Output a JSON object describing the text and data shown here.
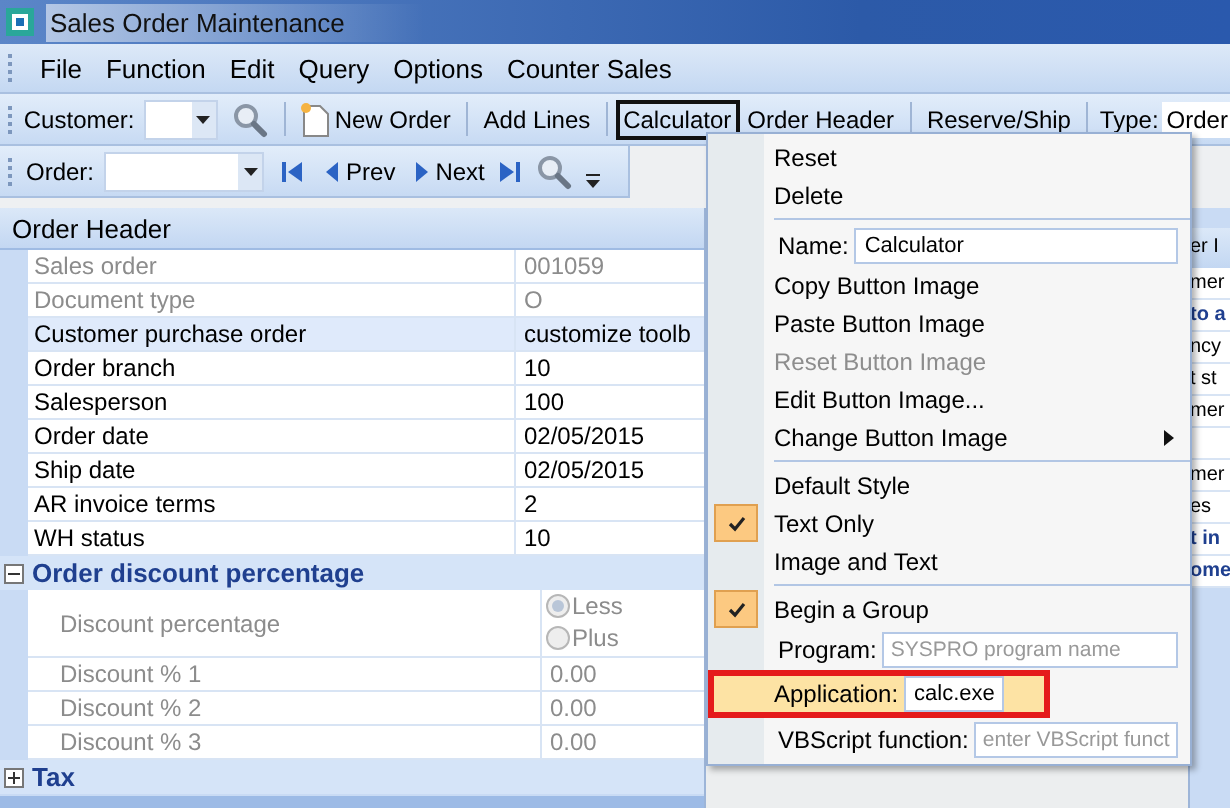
{
  "window": {
    "title": "Sales Order Maintenance"
  },
  "menu_bar": [
    "File",
    "Function",
    "Edit",
    "Query",
    "Options",
    "Counter Sales"
  ],
  "toolbar_1": [
    {
      "kind": "label",
      "text": "Customer:"
    },
    {
      "kind": "combo"
    },
    {
      "kind": "search"
    },
    {
      "kind": "sep"
    },
    {
      "kind": "doc",
      "text": "New Order",
      "selected": false
    },
    {
      "kind": "sep"
    },
    {
      "kind": "button",
      "text": "Add Lines",
      "selected": false
    },
    {
      "kind": "sep"
    },
    {
      "kind": "button",
      "text": "Calculator",
      "selected": true
    },
    {
      "kind": "button",
      "text": "Order Header",
      "selected": false
    },
    {
      "kind": "sep"
    },
    {
      "kind": "button",
      "text": "Reserve/Ship",
      "selected": false
    },
    {
      "kind": "sep"
    },
    {
      "kind": "label",
      "text": "Type:"
    },
    {
      "kind": "value",
      "text": "Order"
    }
  ],
  "toolbar_2": [
    {
      "kind": "label",
      "text": "Order:"
    },
    {
      "kind": "combo"
    },
    {
      "kind": "first"
    },
    {
      "kind": "prev",
      "text": "Prev"
    },
    {
      "kind": "next",
      "text": "Next"
    },
    {
      "kind": "last"
    },
    {
      "kind": "search"
    },
    {
      "kind": "overflow"
    }
  ],
  "property_grid": {
    "title": "Order Header",
    "rows": [
      {
        "label": "Sales order",
        "value": "001059",
        "disabled": true,
        "selected": false
      },
      {
        "label": "Document type",
        "value": "O",
        "disabled": true,
        "selected": false
      },
      {
        "label": "Customer purchase order",
        "value": "customize toolb",
        "disabled": false,
        "selected": true
      },
      {
        "label": "Order branch",
        "value": "10",
        "disabled": false,
        "selected": false
      },
      {
        "label": "Salesperson",
        "value": "100",
        "disabled": false,
        "selected": false
      },
      {
        "label": "Order date",
        "value": "02/05/2015",
        "disabled": false,
        "selected": false
      },
      {
        "label": "Ship date",
        "value": "02/05/2015",
        "disabled": false,
        "selected": false
      },
      {
        "label": "AR invoice terms",
        "value": "2",
        "disabled": false,
        "selected": false
      },
      {
        "label": "WH status",
        "value": "10",
        "disabled": false,
        "selected": false
      }
    ],
    "groups": [
      {
        "title": "Order discount percentage",
        "expanded": true,
        "rows": [
          {
            "kind": "radio",
            "label": "Discount percentage",
            "options": [
              {
                "label": "Less",
                "selected": true
              },
              {
                "label": "Plus",
                "selected": false
              }
            ]
          },
          {
            "kind": "text",
            "label": "Discount % 1",
            "value": "0.00"
          },
          {
            "kind": "text",
            "label": "Discount % 2",
            "value": "0.00"
          },
          {
            "kind": "text",
            "label": "Discount % 3",
            "value": "0.00"
          }
        ]
      },
      {
        "title": "Tax",
        "expanded": false
      }
    ]
  },
  "side_panel": {
    "header": "er I",
    "rows": [
      {
        "text": "mer",
        "bold": false
      },
      {
        "text": "to a",
        "bold": true
      },
      {
        "text": "ncy",
        "bold": false
      },
      {
        "text": "t st",
        "bold": false
      },
      {
        "text": "mer",
        "bold": false
      },
      {},
      {
        "text": "mer",
        "bold": false
      },
      {
        "text": "es",
        "bold": false
      },
      {
        "text": "t in",
        "bold": true
      },
      {
        "text": "ome",
        "bold": true
      }
    ]
  },
  "context_menu": [
    {
      "kind": "item",
      "text": "Reset",
      "checked": false,
      "disabled": false
    },
    {
      "kind": "item",
      "text": "Delete",
      "checked": false,
      "disabled": false
    },
    {
      "kind": "separator"
    },
    {
      "kind": "field",
      "label": "Name:",
      "value": "Calculator",
      "highlighted": false
    },
    {
      "kind": "item",
      "text": "Copy Button Image",
      "checked": false,
      "disabled": false
    },
    {
      "kind": "item",
      "text": "Paste Button Image",
      "checked": false,
      "disabled": false
    },
    {
      "kind": "item",
      "text": "Reset Button Image",
      "checked": false,
      "disabled": true
    },
    {
      "kind": "item",
      "text": "Edit Button Image...",
      "checked": false,
      "disabled": false
    },
    {
      "kind": "submenu",
      "text": "Change Button Image",
      "checked": false,
      "disabled": false
    },
    {
      "kind": "separator"
    },
    {
      "kind": "item",
      "text": "Default Style",
      "checked": false,
      "disabled": false
    },
    {
      "kind": "item",
      "text": "Text Only",
      "checked": true,
      "disabled": false
    },
    {
      "kind": "item",
      "text": "Image and Text",
      "checked": false,
      "disabled": false
    },
    {
      "kind": "separator"
    },
    {
      "kind": "item",
      "text": "Begin a Group",
      "checked": true,
      "disabled": false
    },
    {
      "kind": "field",
      "label": "Program:",
      "placeholder": "SYSPRO program name",
      "highlighted": false
    },
    {
      "kind": "field",
      "label": "Application:",
      "value": "calc.exe",
      "highlighted": true
    },
    {
      "kind": "field",
      "label": "VBScript function:",
      "placeholder": "enter VBScript funct",
      "highlighted": false
    }
  ]
}
